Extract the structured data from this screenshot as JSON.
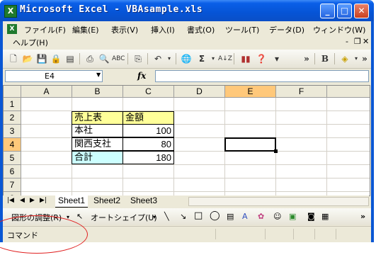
{
  "window": {
    "title": "Microsoft Excel - VBAsample.xls",
    "app_icon": "excel-icon",
    "controls": [
      "minimize",
      "maximize",
      "close"
    ]
  },
  "menu": {
    "items": [
      "ファイル(F)",
      "編集(E)",
      "表示(V)",
      "挿入(I)",
      "書式(O)",
      "ツール(T)",
      "データ(D)",
      "ウィンドウ(W)",
      "ヘルプ(H)"
    ]
  },
  "toolbar": {
    "icons": [
      "new-icon",
      "open-icon",
      "save-icon",
      "permission-icon",
      "print-preview-icon",
      "print-icon",
      "search-icon",
      "spellcheck-icon",
      "copy-icon",
      "undo-icon",
      "hyperlink-icon",
      "autosum-icon",
      "sort-ascending-icon",
      "chart-wizard-icon",
      "help-icon",
      "bold-icon",
      "fill-color-icon"
    ],
    "autosum_glyph": "Σ",
    "bold_glyph": "B"
  },
  "formula_bar": {
    "name_box": "E4",
    "fx_label": "fx",
    "value": ""
  },
  "sheet": {
    "columns": [
      "A",
      "B",
      "C",
      "D",
      "E",
      "F"
    ],
    "rows": [
      "1",
      "2",
      "3",
      "4",
      "5",
      "6",
      "7",
      "8"
    ],
    "selected_column": "E",
    "selected_row": "4",
    "cells": {
      "B2": "売上表",
      "C2": "金額",
      "B3": "本社",
      "C3": "100",
      "B4": "関西支社",
      "C4": "80",
      "B5": "合計",
      "C5": "180"
    }
  },
  "tabs": {
    "sheets": [
      "Sheet1",
      "Sheet2",
      "Sheet3"
    ],
    "active": "Sheet1"
  },
  "drawing_toolbar": {
    "draw_menu": "図形の調整(R)",
    "autoshapes_menu": "オートシェイプ(U)"
  },
  "status_bar": {
    "text": "コマンド"
  },
  "colors": {
    "title_bar": "#0a57d4",
    "header_highlight": "#ffc87a",
    "yellow_cell": "#ffff99",
    "cyan_cell": "#ccffff",
    "annotation_ellipse": "#e02020"
  }
}
